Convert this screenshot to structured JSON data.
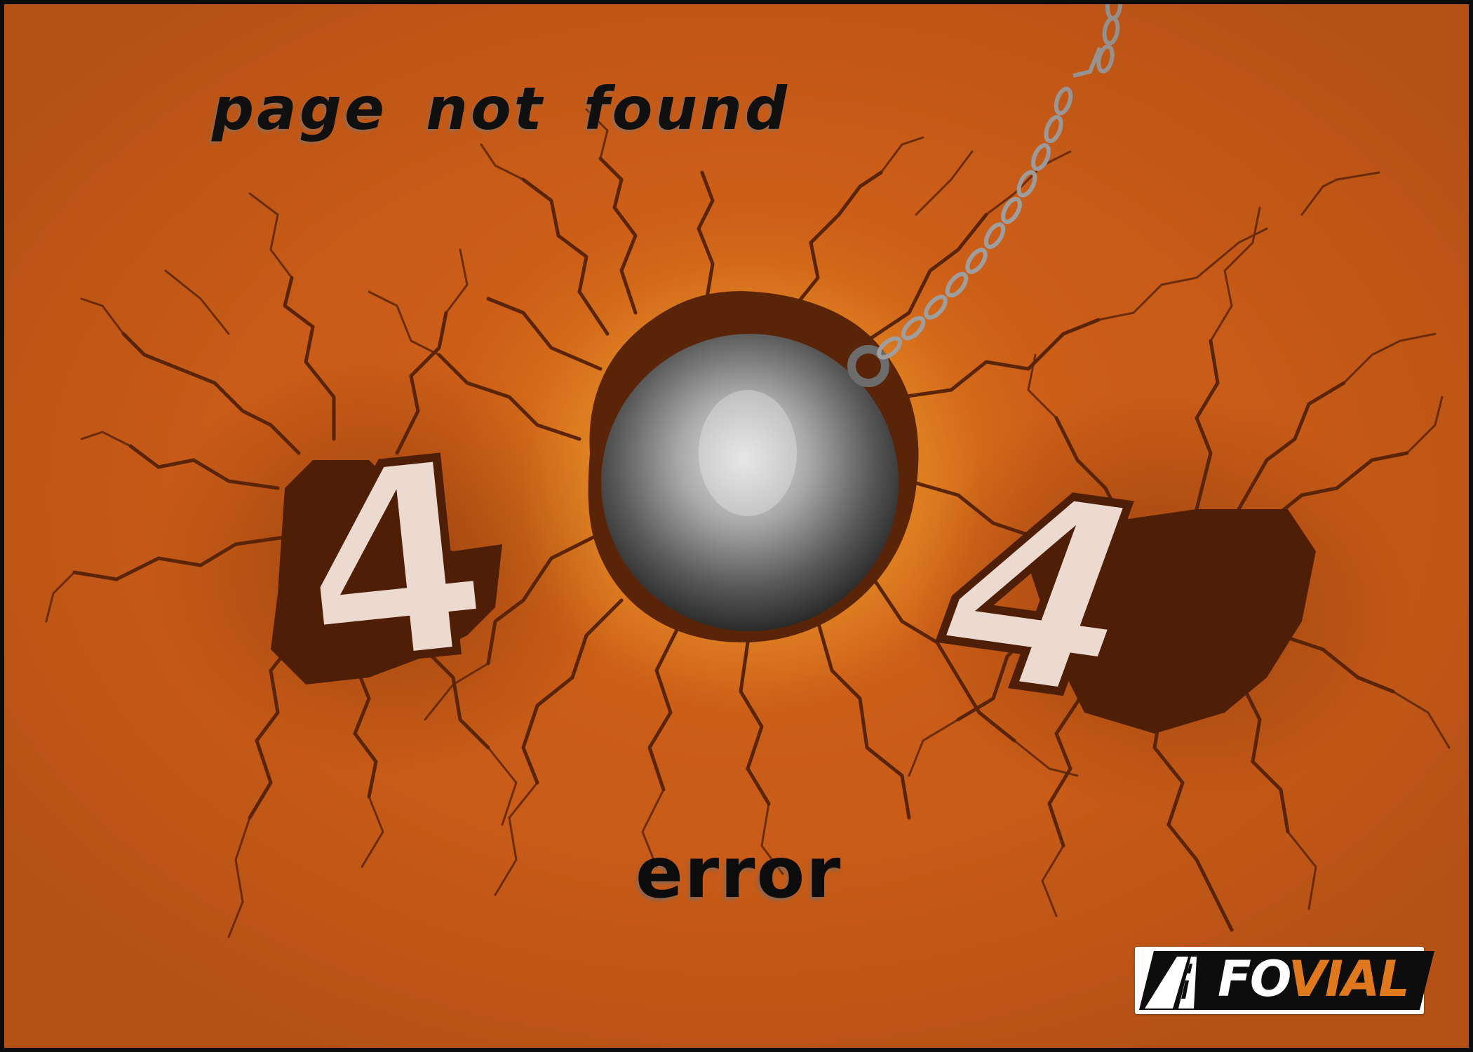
{
  "page": {
    "heading": "page not found",
    "digit_left": "4",
    "digit_right": "4",
    "error_label": "error"
  },
  "logo": {
    "fo": "FO",
    "vial": "VIAL"
  },
  "colors": {
    "background": "#d2661a",
    "crack": "#5a2408",
    "digit_fill": "#ecd9cf",
    "logo_accent": "#e0781e"
  }
}
